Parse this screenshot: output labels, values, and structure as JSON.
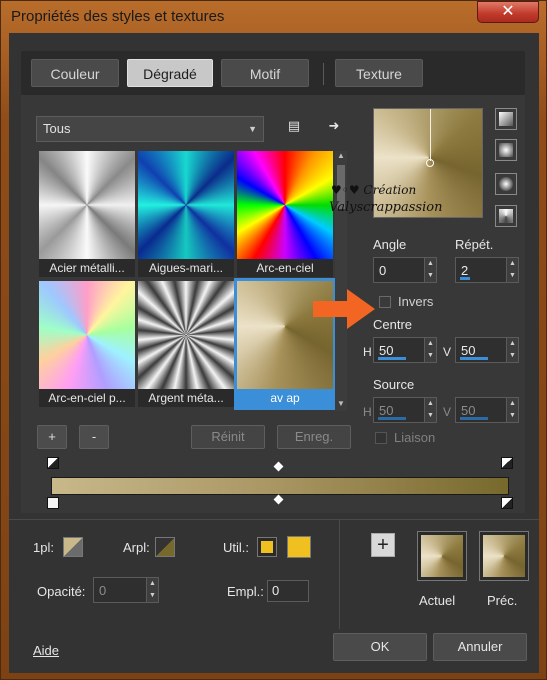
{
  "window": {
    "title": "Propriétés des styles et textures",
    "close_glyph": "✕"
  },
  "tabs": [
    {
      "label": "Couleur"
    },
    {
      "label": "Dégradé",
      "active": true
    },
    {
      "label": "Motif"
    },
    {
      "label": "Texture"
    }
  ],
  "category_select": {
    "value": "Tous"
  },
  "gradients": [
    {
      "label": "Acier métalli..."
    },
    {
      "label": "Aigues-mari..."
    },
    {
      "label": "Arc-en-ciel"
    },
    {
      "label": "Arc-en-ciel p..."
    },
    {
      "label": "Argent méta..."
    },
    {
      "label": "av ap",
      "selected": true
    }
  ],
  "list_buttons": {
    "add": "+",
    "remove": "-",
    "reset": "Réinit",
    "save": "Enreg."
  },
  "watermark": {
    "line1": "♥◦♥ Création",
    "line2": "Valyscrappassion"
  },
  "angle": {
    "label": "Angle",
    "value": "0"
  },
  "repeat": {
    "label": "Répét.",
    "value": "2"
  },
  "invert": {
    "label": "Invers",
    "checked": false
  },
  "center": {
    "label": "Centre",
    "h_label": "H",
    "h_value": "50",
    "v_label": "V",
    "v_value": "50"
  },
  "source": {
    "label": "Source",
    "h_label": "H",
    "h_value": "50",
    "v_label": "V",
    "v_value": "50"
  },
  "link_option": {
    "label": "Liaison",
    "checked": false
  },
  "bottom": {
    "fg_label": "1pl:",
    "bg_label": "Arpl:",
    "util_label": "Util.:",
    "opacity_label": "Opacité:",
    "opacity_value": "0",
    "location_label": "Empl.:",
    "location_value": "0",
    "util_color": "#f0c020"
  },
  "result": {
    "add_glyph": "+",
    "current_label": "Actuel",
    "previous_label": "Préc."
  },
  "footer": {
    "help": "Aide",
    "ok": "OK",
    "cancel": "Annuler"
  },
  "colors": {
    "accent": "#3a8fd8",
    "arrow": "#f26522",
    "window_border": "#b96d2b"
  }
}
